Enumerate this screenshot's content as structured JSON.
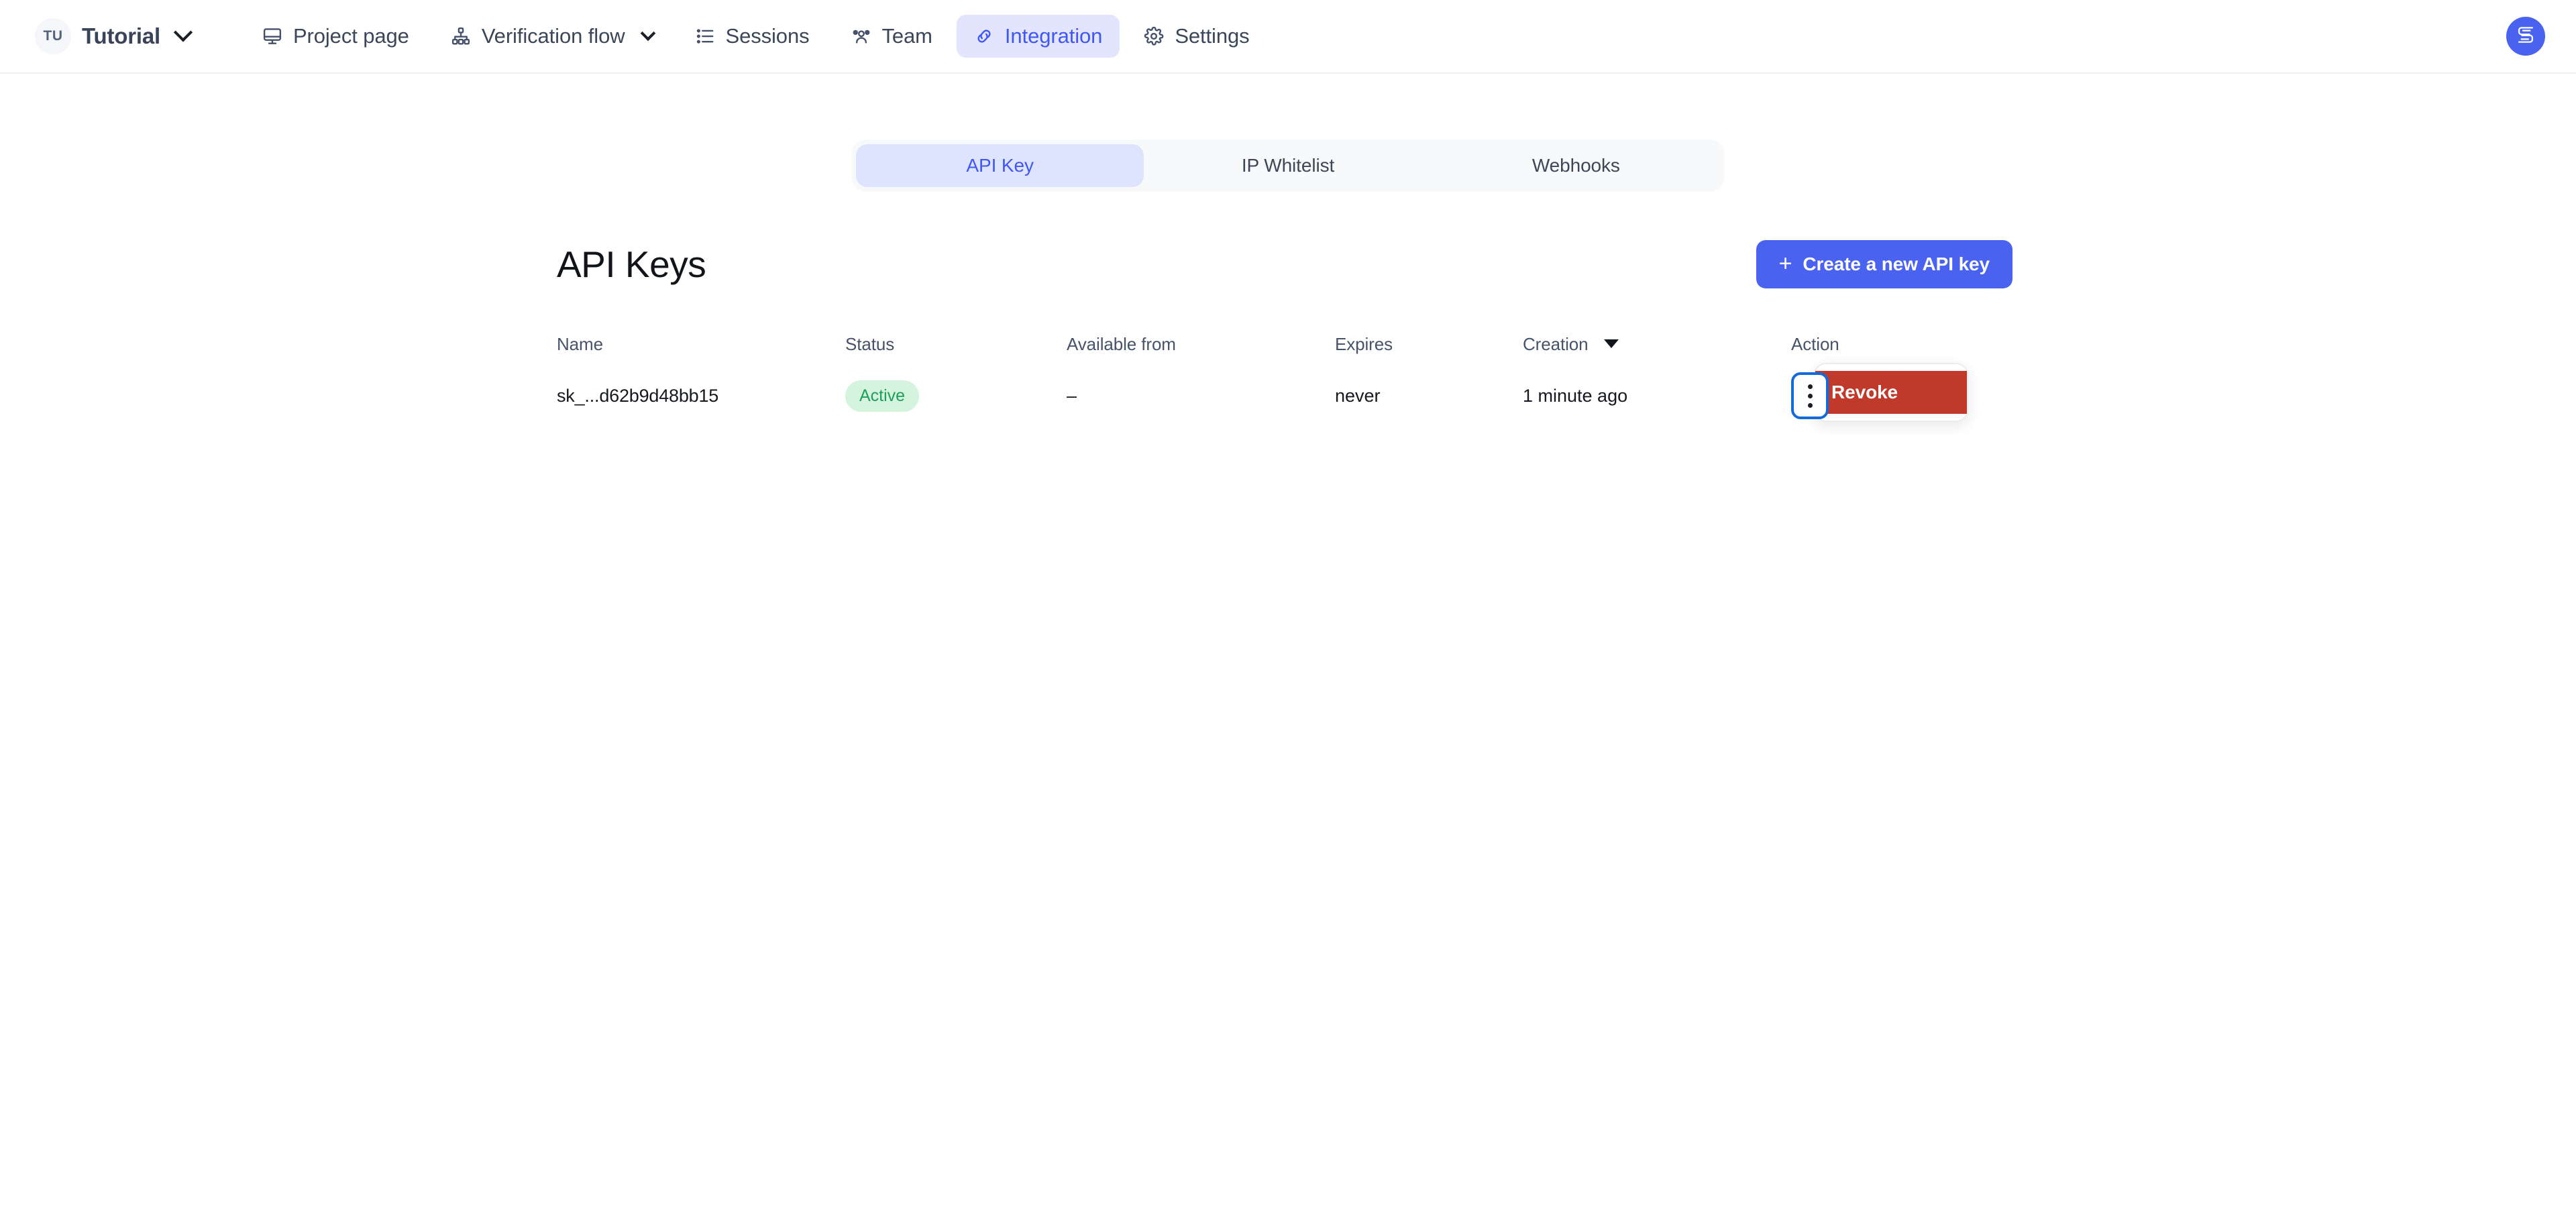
{
  "topbar": {
    "workspace": {
      "initials": "TU",
      "name": "Tutorial",
      "chevron_icon": "chevron-down-icon"
    },
    "nav": [
      {
        "label": "Project page",
        "icon": "monitor-icon",
        "active": false,
        "has_chevron": false
      },
      {
        "label": "Verification flow",
        "icon": "sitemap-icon",
        "active": false,
        "has_chevron": true
      },
      {
        "label": "Sessions",
        "icon": "list-icon",
        "active": false,
        "has_chevron": false
      },
      {
        "label": "Team",
        "icon": "users-icon",
        "active": false,
        "has_chevron": false
      },
      {
        "label": "Integration",
        "icon": "link-icon",
        "active": true,
        "has_chevron": false
      },
      {
        "label": "Settings",
        "icon": "gear-icon",
        "active": false,
        "has_chevron": false
      }
    ],
    "user_avatar": {
      "icon": "s-logo-icon"
    }
  },
  "tabs": {
    "items": [
      {
        "label": "API Key",
        "active": true
      },
      {
        "label": "IP Whitelist",
        "active": false
      },
      {
        "label": "Webhooks",
        "active": false
      }
    ]
  },
  "main": {
    "title": "API Keys",
    "create_button": {
      "label": "Create a new API key",
      "icon": "plus-icon"
    },
    "table": {
      "columns": [
        "Name",
        "Status",
        "Available from",
        "Expires",
        "Creation",
        "Action"
      ],
      "sorted_column": "Creation",
      "sort_direction": "desc",
      "rows": [
        {
          "name": "sk_...d62b9d48bb15",
          "status": "Active",
          "available_from": "–",
          "expires": "never",
          "creation": "1 minute ago",
          "action": {
            "kebab_icon": "more-vertical-icon"
          }
        }
      ]
    },
    "action_menu": {
      "open": true,
      "items": [
        {
          "label": "Revoke",
          "variant": "danger",
          "hovered": true
        }
      ]
    }
  },
  "colors": {
    "brand_blue": "#4a62f0",
    "active_tab_bg": "#e2e5fd",
    "active_tab_text": "#4057f5",
    "badge_bg": "#d4f4de",
    "badge_text": "#1f9e5c",
    "danger_red": "#c0392b",
    "focus_ring": "#1669d8"
  }
}
